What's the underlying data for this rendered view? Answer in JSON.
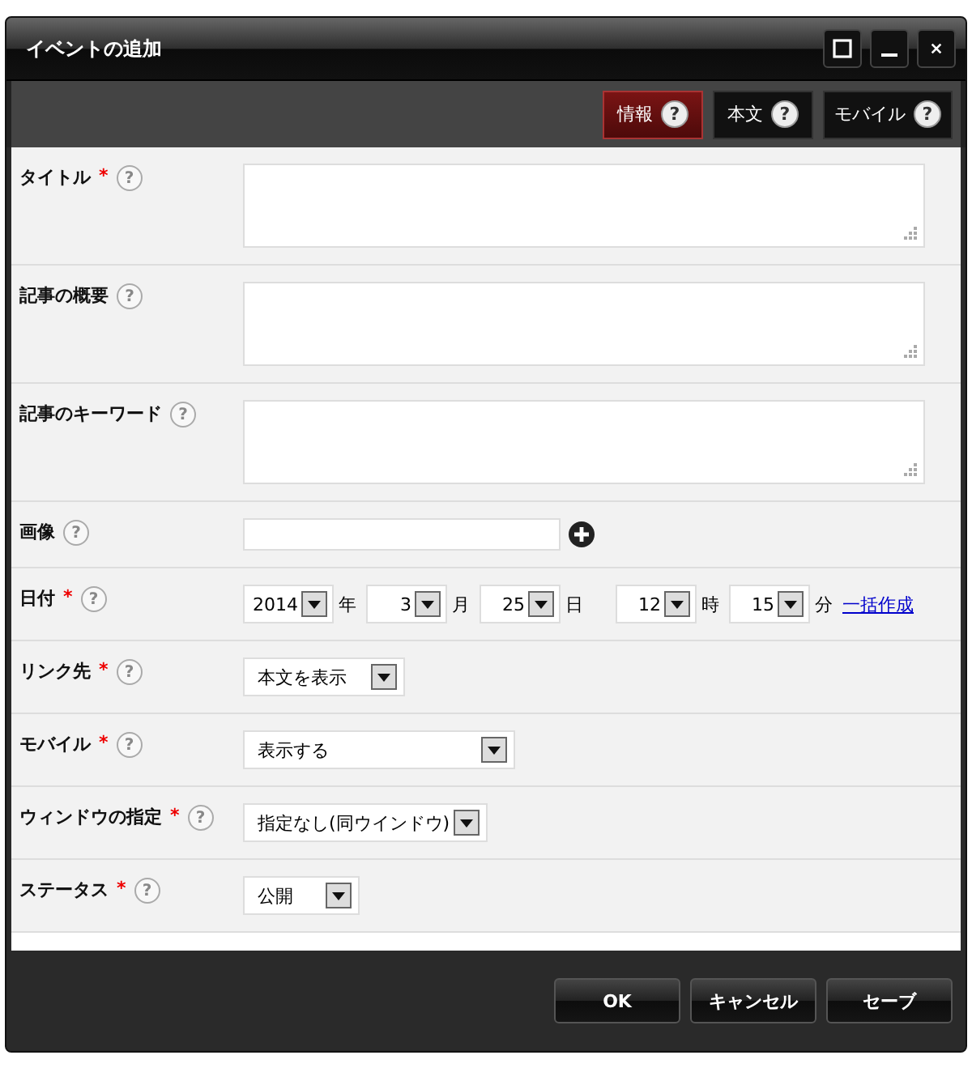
{
  "window": {
    "title": "イベントの追加"
  },
  "tabs": [
    {
      "label": "情報",
      "help": "?",
      "selected": true
    },
    {
      "label": "本文",
      "help": "?",
      "selected": false
    },
    {
      "label": "モバイル",
      "help": "?",
      "selected": false
    }
  ],
  "fields": [
    {
      "kind": "textarea",
      "label": "タイトル",
      "required_mark": "*",
      "help": "?"
    },
    {
      "kind": "textarea",
      "label": "記事の概要",
      "help": "?"
    },
    {
      "kind": "textarea",
      "label": "記事のキーワード",
      "help": "?"
    },
    {
      "kind": "file",
      "label": "画像",
      "help": "?"
    },
    {
      "kind": "date",
      "label": "日付",
      "required_mark": "*",
      "help": "?",
      "parts": [
        {
          "value": "2014",
          "unit": "年"
        },
        {
          "value": "3",
          "unit": "月"
        },
        {
          "value": "25",
          "unit": "日"
        },
        {
          "value": "12",
          "unit": "時"
        },
        {
          "value": "15",
          "unit": "分"
        }
      ],
      "link": "一括作成"
    },
    {
      "kind": "select",
      "label": "リンク先",
      "required_mark": "*",
      "help": "?",
      "value": "本文を表示"
    },
    {
      "kind": "select",
      "label": "モバイル",
      "required_mark": "*",
      "help": "?",
      "value": "表示する"
    },
    {
      "kind": "select",
      "label": "ウィンドウの指定",
      "required_mark": "*",
      "help": "?",
      "value": "指定なし(同ウインドウ)"
    },
    {
      "kind": "select",
      "label": "ステータス",
      "required_mark": "*",
      "help": "?",
      "value": "公開"
    }
  ],
  "buttons": [
    "OK",
    "キャンセル",
    "セーブ"
  ]
}
